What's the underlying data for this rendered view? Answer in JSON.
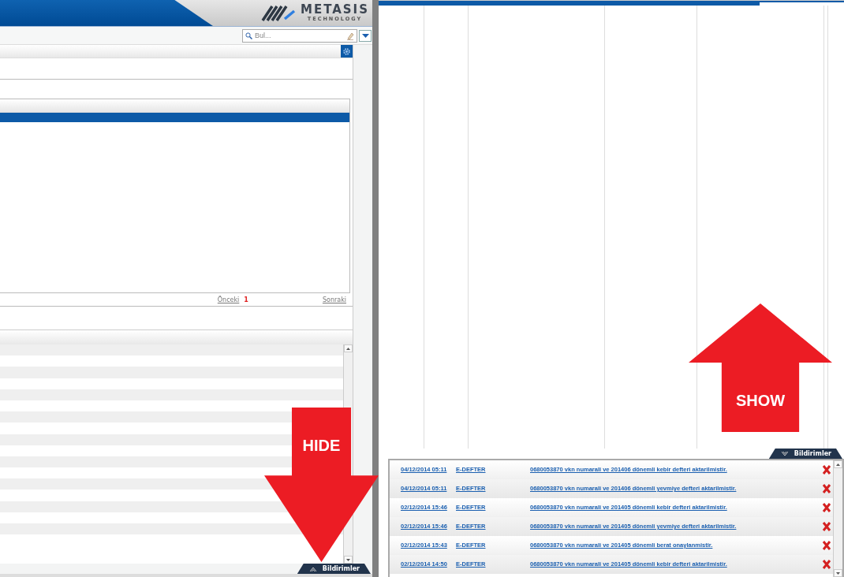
{
  "left_pane": {
    "logo": {
      "name": "METASIS",
      "tagline": "TECHNOLOGY"
    },
    "search": {
      "placeholder": "Bul..."
    },
    "table": {
      "rows": [
        {
          "selected": true
        }
      ]
    },
    "pager": {
      "previous": "Önceki",
      "page": "1",
      "next": "Sonraki"
    },
    "notifications_tab": {
      "label": "Bildirimler",
      "expanded": false
    }
  },
  "right_pane": {
    "notifications_tab": {
      "label": "Bildirimler",
      "expanded": true
    },
    "notifications": [
      {
        "date": "04/12/2014 05:11",
        "source": "E-DEFTER",
        "message": "0680053870 vkn numarali ve 201406 dönemli kebir defteri aktarilmistir."
      },
      {
        "date": "04/12/2014 05:11",
        "source": "E-DEFTER",
        "message": "0680053870 vkn numarali ve 201406 dönemli yevmiye defteri aktarilmistir."
      },
      {
        "date": "02/12/2014 15:46",
        "source": "E-DEFTER",
        "message": "0680053870 vkn numarali ve 201405 dönemli kebir defteri aktarilmistir."
      },
      {
        "date": "02/12/2014 15:46",
        "source": "E-DEFTER",
        "message": "0680053870 vkn numarali ve 201405 dönemli yevmiye defteri aktarilmistir."
      },
      {
        "date": "02/12/2014 15:43",
        "source": "E-DEFTER",
        "message": "0680053870 vkn numarali ve 201405 dönemli berat onaylanmistir."
      },
      {
        "date": "02/12/2014 14:50",
        "source": "E-DEFTER",
        "message": "0680053870 vkn numarali ve 201405 dönemli kebir defteri aktarilmistir."
      }
    ]
  },
  "annotations": [
    {
      "kind": "down",
      "label": "HIDE"
    },
    {
      "kind": "up",
      "label": "SHOW"
    }
  ]
}
